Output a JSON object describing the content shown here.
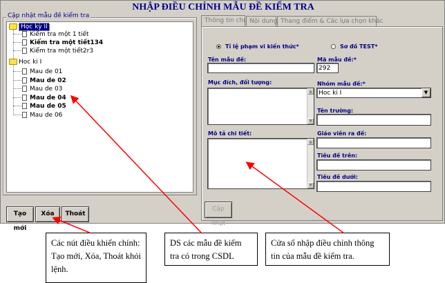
{
  "window": {
    "title": "NHẬP ĐIỀU CHỈNH MẪU ĐỀ KIỂM TRA"
  },
  "tree": {
    "legend": "Cập nhật mẫu đề kiểm tra",
    "group1": {
      "label": "Học kỳ II",
      "items": [
        "Kiểm tra một 1 tiết",
        "Kiểm tra một tiết134",
        "Kiểm tra một tiết2r3"
      ]
    },
    "group2": {
      "label": "Hoc ki I",
      "items": [
        "Mau de 01",
        "Mau de 02",
        "Mau de 03",
        "Mau de 04",
        "Mau de 05",
        "Mau de 06"
      ]
    }
  },
  "buttons": {
    "new": "Tạo mới",
    "delete": "Xóa",
    "exit": "Thoát",
    "update": "Cập nhật"
  },
  "tabs": [
    "Thông tin chung",
    "Nội dung",
    "Thang điểm & Các lựa chọn khác"
  ],
  "form": {
    "radio1": "Tỉ lệ phạm vi kiến thức*",
    "radio2": "Sơ đồ TEST*",
    "ten_mau_de": {
      "label": "Tên mẫu đề:",
      "value": ""
    },
    "ma_mau_de": {
      "label": "Mã mẫu đề:*",
      "value": "292"
    },
    "muc_dich": {
      "label": "Mục đích, đối tượng:"
    },
    "nhom_mau_de": {
      "label": "Nhóm mẫu đề:*",
      "value": "Hoc ki I"
    },
    "ten_truong": {
      "label": "Tên trường:"
    },
    "mo_ta": {
      "label": "Mô tả chi tiết:"
    },
    "giao_vien": {
      "label": "Giáo viên ra đề:"
    },
    "tieu_de_tren": {
      "label": "Tiêu đề trên:"
    },
    "tieu_de_duoi": {
      "label": "Tiêu đề dưới:"
    }
  },
  "annotations": {
    "buttons_note": "Các nút điều khiển chính: Tạo mới, Xóa, Thoát khỏi lệnh.",
    "list_note": "DS các mẫu đề kiểm tra có trong CSDL",
    "form_note": "Cửa sổ nhập điều chỉnh thông tin của mẫu đề kiểm tra."
  },
  "colors": {
    "title": "#00008b",
    "label": "#000080",
    "arrow": "#ff0000",
    "window": "#d4d0c8"
  }
}
